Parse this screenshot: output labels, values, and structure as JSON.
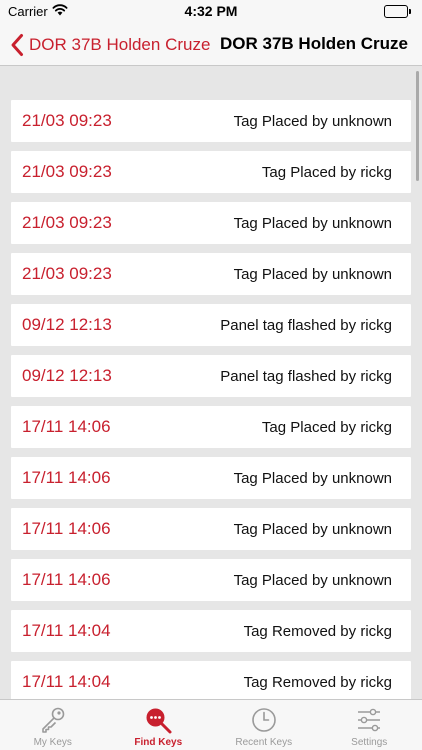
{
  "status_bar": {
    "carrier": "Carrier",
    "time": "4:32 PM"
  },
  "nav": {
    "back_label": "DOR 37B Holden Cruze",
    "title": "DOR 37B Holden Cruze"
  },
  "events": [
    {
      "date": "21/03 09:23",
      "event": "Tag Placed by unknown"
    },
    {
      "date": "21/03 09:23",
      "event": "Tag Placed by rickg"
    },
    {
      "date": "21/03 09:23",
      "event": "Tag Placed by unknown"
    },
    {
      "date": "21/03 09:23",
      "event": "Tag Placed by unknown"
    },
    {
      "date": "09/12 12:13",
      "event": "Panel tag flashed by rickg"
    },
    {
      "date": "09/12 12:13",
      "event": "Panel tag flashed by rickg"
    },
    {
      "date": "17/11 14:06",
      "event": "Tag Placed by rickg"
    },
    {
      "date": "17/11 14:06",
      "event": "Tag Placed by unknown"
    },
    {
      "date": "17/11 14:06",
      "event": "Tag Placed by unknown"
    },
    {
      "date": "17/11 14:06",
      "event": "Tag Placed by unknown"
    },
    {
      "date": "17/11 14:04",
      "event": "Tag Removed by rickg"
    },
    {
      "date": "17/11 14:04",
      "event": "Tag Removed by rickg"
    }
  ],
  "tabs": [
    {
      "label": "My Keys",
      "icon": "key-icon",
      "active": false
    },
    {
      "label": "Find Keys",
      "icon": "find-keys-icon",
      "active": true
    },
    {
      "label": "Recent Keys",
      "icon": "clock-icon",
      "active": false
    },
    {
      "label": "Settings",
      "icon": "sliders-icon",
      "active": false
    }
  ],
  "colors": {
    "accent": "#c8202e",
    "inactive": "#9a9a9a",
    "background": "#e6e6e6"
  }
}
